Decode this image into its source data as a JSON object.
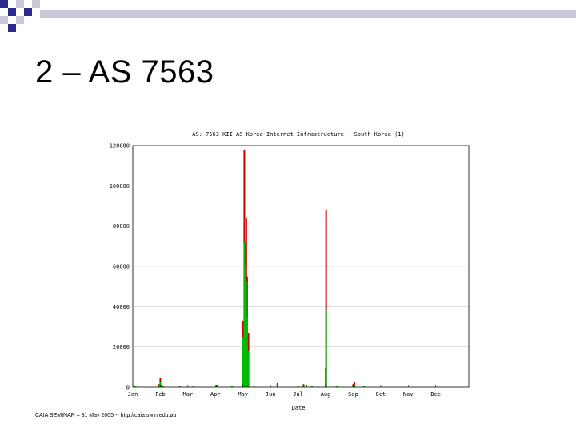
{
  "slide": {
    "title": "2 – AS 7563",
    "footer": "CAIA SEMINAR – 31 May 2005 -- http://caia.swin.edu.au"
  },
  "colors": {
    "deco_dark": "#2b2b8f",
    "deco_light": "#c8c8d8",
    "series_red": "#cc0000",
    "series_green": "#00bb00",
    "grid": "#cccccc"
  },
  "chart_data": {
    "type": "bar",
    "title": "AS: 7563 KII-AS Korea Internet Infrastructure - South Korea (1)",
    "xlabel": "Date",
    "ylabel": "",
    "ylim": [
      0,
      120000
    ],
    "yticks": [
      0,
      20000,
      40000,
      60000,
      80000,
      100000,
      120000
    ],
    "ytick_labels": [
      "0",
      "20000",
      "40000",
      "60000",
      "80000",
      "100000",
      "120000"
    ],
    "xlim": [
      0,
      12.2
    ],
    "months": [
      "Jan",
      "Feb",
      "Mar",
      "Apr",
      "May",
      "Jun",
      "Jul",
      "Aug",
      "Sep",
      "Oct",
      "Nov",
      "Dec"
    ],
    "grid": true,
    "series": [
      {
        "x": [
          0.1,
          0.95,
          1.0,
          1.05,
          1.1,
          1.7,
          2.2,
          3.05,
          3.6,
          4.0,
          4.05,
          4.08,
          4.12,
          4.15,
          4.2,
          4.4,
          5.25,
          6.0,
          6.2,
          6.3,
          6.5,
          7.0,
          7.02,
          7.4,
          8.0,
          8.05,
          8.4
        ],
        "values": [
          800,
          1500,
          4500,
          1200,
          800,
          500,
          800,
          1200,
          600,
          33000,
          118000,
          72000,
          84000,
          55000,
          27000,
          800,
          2000,
          600,
          1500,
          1200,
          700,
          9500,
          88000,
          800,
          1500,
          2500,
          700
        ]
      },
      {
        "x": [
          0.1,
          0.95,
          1.0,
          1.05,
          1.1,
          1.7,
          2.2,
          3.05,
          3.6,
          4.0,
          4.05,
          4.08,
          4.12,
          4.15,
          4.2,
          4.4,
          5.25,
          6.0,
          6.2,
          6.3,
          6.5,
          7.0,
          7.02,
          7.4,
          8.0,
          8.05,
          8.4
        ],
        "values": [
          500,
          1000,
          2500,
          800,
          500,
          300,
          500,
          800,
          400,
          25000,
          72000,
          60000,
          52000,
          35000,
          18000,
          500,
          1000,
          400,
          800,
          700,
          400,
          9000,
          38000,
          500,
          800,
          1200,
          400
        ]
      }
    ]
  }
}
